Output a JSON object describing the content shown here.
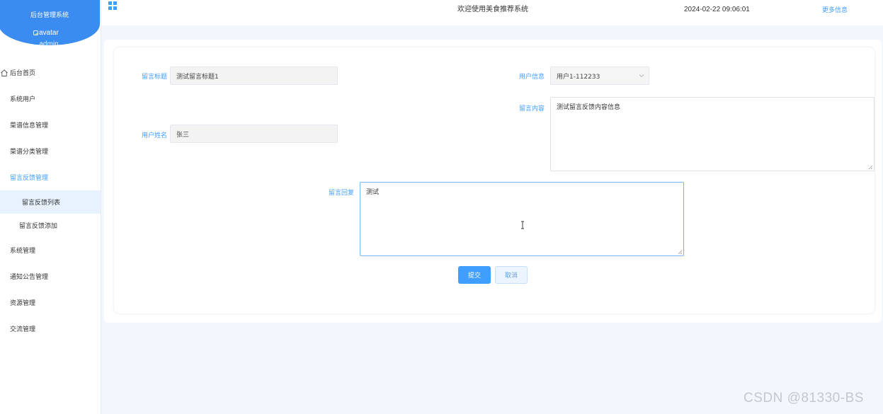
{
  "sidebar": {
    "system_title": "后台管理系统",
    "avatar_alt": "avatar",
    "username": "admin",
    "menu": [
      {
        "label": "后台首页"
      },
      {
        "label": "系统用户"
      },
      {
        "label": "菜谱信息管理"
      },
      {
        "label": "菜谱分类管理"
      },
      {
        "label": "留言反馈管理"
      }
    ],
    "submenu": [
      {
        "label": "留言反馈列表"
      },
      {
        "label": "留言反馈添加"
      }
    ],
    "menu_after": [
      {
        "label": "系统管理"
      },
      {
        "label": "通知公告管理"
      },
      {
        "label": "资源管理"
      },
      {
        "label": "交流管理"
      }
    ]
  },
  "header": {
    "welcome": "欢迎使用美食推荐系统",
    "datetime": "2024-02-22 09:06:01",
    "more": "更多信息"
  },
  "form": {
    "title_label": "留言标题",
    "title_value": "测试留言标题1",
    "userinfo_label": "用户信息",
    "userinfo_value": "用户1-112233",
    "content_label": "留言内容",
    "content_value": "测试留言反馈内容信息",
    "name_label": "用户姓名",
    "name_value": "张三",
    "reply_label": "留言回复",
    "reply_value": "测试",
    "submit": "提交",
    "cancel": "取消"
  },
  "watermark": "CSDN @81330-BS",
  "colors": {
    "primary": "#409eff",
    "sidebar_header": "#3b8cf0",
    "main_bg": "#f2f7fd"
  }
}
